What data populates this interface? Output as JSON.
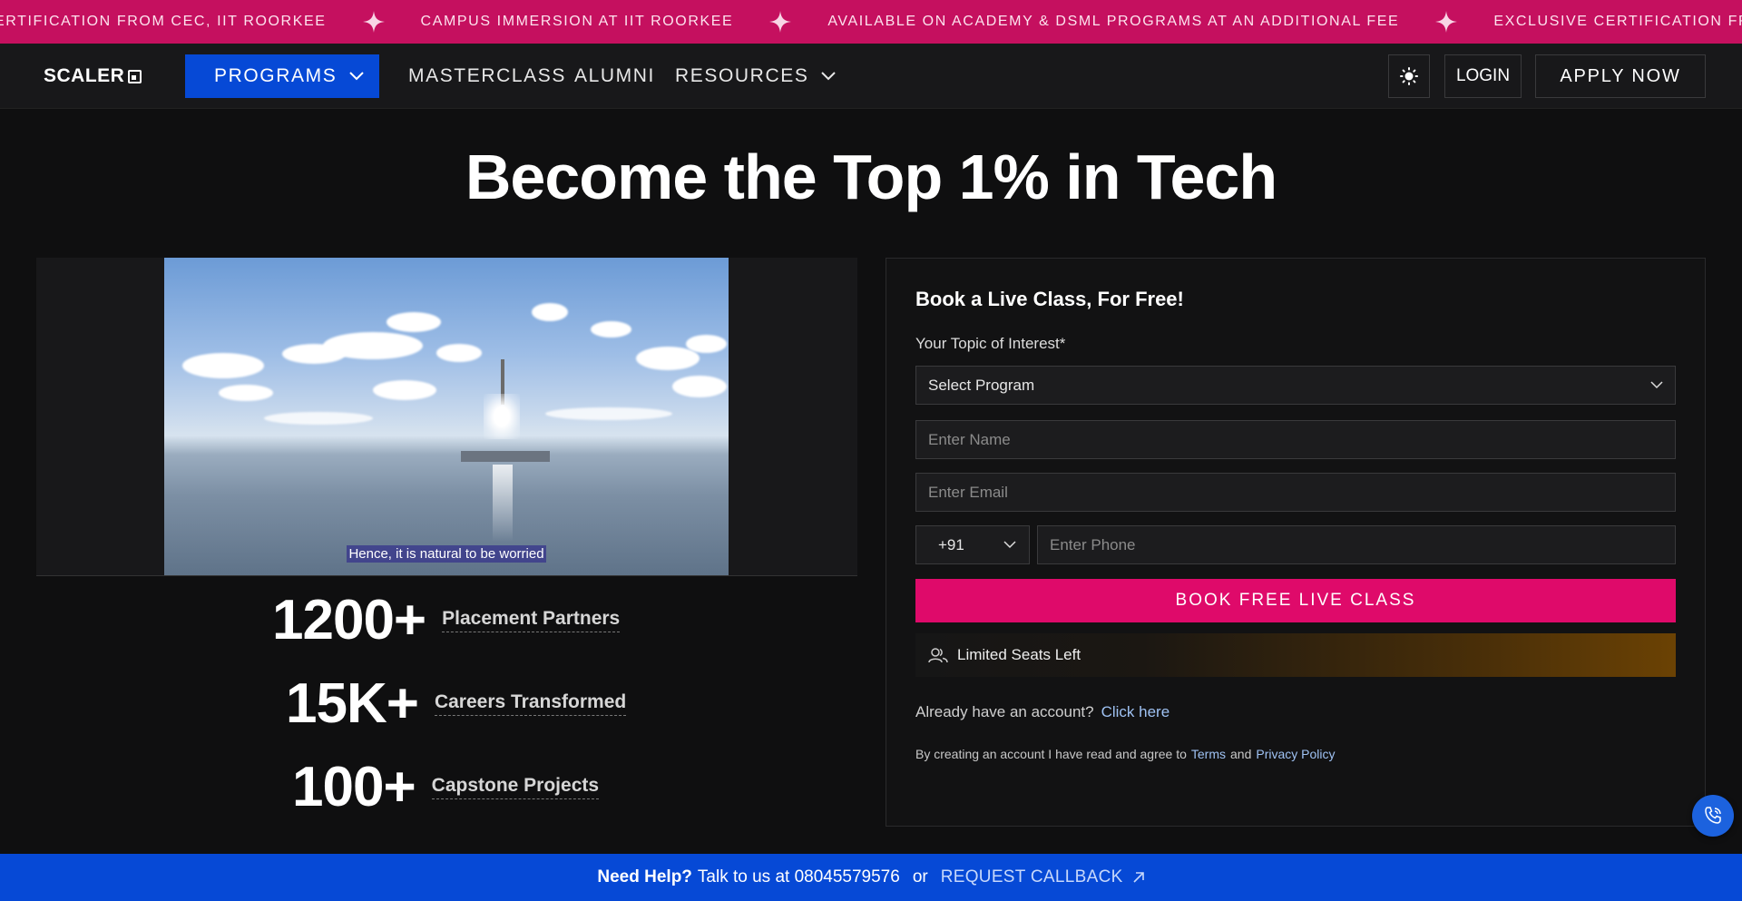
{
  "ticker": {
    "items": [
      "ERTIFICATION FROM CEC, IIT ROORKEE",
      "CAMPUS IMMERSION AT IIT ROORKEE",
      "AVAILABLE ON ACADEMY & DSML PROGRAMS AT AN ADDITIONAL FEE",
      "EXCLUSIVE CERTIFICATION FROM CEC, IIT ROORKEE"
    ],
    "color": "#c5105f"
  },
  "nav": {
    "logo": "SCALER",
    "programs": "PROGRAMS",
    "masterclass": "MASTERCLASS",
    "alumni": "ALUMNI",
    "resources": "RESOURCES",
    "login": "LOGIN",
    "apply": "APPLY NOW",
    "accent": "#0649d6"
  },
  "hero": {
    "title": "Become the Top 1% in Tech"
  },
  "video": {
    "caption": "Hence, it is natural to be worried"
  },
  "stats": [
    {
      "value": "1200+",
      "label": "Placement Partners"
    },
    {
      "value": "15K+",
      "label": "Careers Transformed"
    },
    {
      "value": "100+",
      "label": "Capstone Projects"
    }
  ],
  "form": {
    "title": "Book a Live Class, For Free!",
    "topic_label": "Your Topic of Interest*",
    "select_value": "Select Program",
    "name_placeholder": "Enter Name",
    "email_placeholder": "Enter Email",
    "country_code": "+91",
    "phone_placeholder": "Enter Phone",
    "submit": "BOOK FREE LIVE CLASS",
    "seats": "Limited Seats Left",
    "already": "Already have an account?",
    "click_here": "Click here",
    "terms_prefix": "By creating an account I have read and agree to",
    "terms": "Terms",
    "and": "and",
    "privacy": "Privacy Policy",
    "submit_color": "#df0a6a"
  },
  "help": {
    "need_help": "Need Help?",
    "talk": "Talk to us at 08045579576",
    "or": "or",
    "callback": "REQUEST CALLBACK"
  }
}
